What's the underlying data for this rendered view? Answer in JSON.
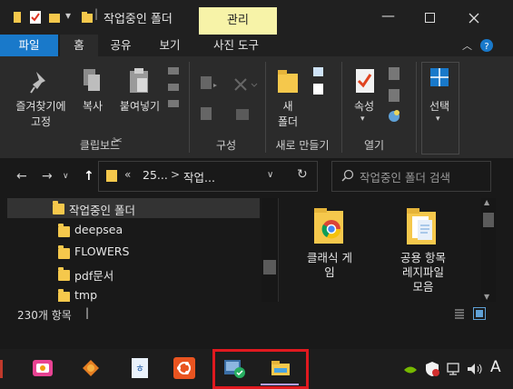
{
  "window": {
    "title": "작업중인 폴더",
    "context_tab": "관리"
  },
  "tabs": [
    "파일",
    "홈",
    "공유",
    "보기",
    "사진 도구"
  ],
  "ribbon": {
    "pin_label_line1": "즐겨찾기에",
    "pin_label_line2": "고정",
    "copy_label": "복사",
    "paste_label": "붙여넣기",
    "new_folder_line1": "새",
    "new_folder_line2": "폴더",
    "properties_label": "속성",
    "select_label": "선택",
    "groups": [
      "클립보드",
      "구성",
      "새로 만들기",
      "열기"
    ]
  },
  "address": {
    "breadcrumb_overflow": "«",
    "crumb1": "25...",
    "crumb_sep": ">",
    "crumb2": "작업...",
    "search_placeholder": "작업중인 폴더 검색"
  },
  "nav_pane": {
    "items": [
      {
        "label": "작업중인 폴더",
        "selected": true
      },
      {
        "label": "deepsea"
      },
      {
        "label": "FLOWERS"
      },
      {
        "label": "pdf문서"
      },
      {
        "label": "tmp"
      }
    ]
  },
  "files": [
    {
      "line1": "클래식 게",
      "line2": "임"
    },
    {
      "line1": "공용 항목",
      "line2": "레지파일",
      "line3": "모음"
    }
  ],
  "status": {
    "item_count": "230개 항목",
    "cursor": "|"
  },
  "taskbar": {
    "ime_label": "A"
  },
  "colors": {
    "file_tab": "#1979ca",
    "manage_tab": "#f7f3a8",
    "folder_yellow": "#f5c84c",
    "highlight_red": "#e0191f"
  }
}
